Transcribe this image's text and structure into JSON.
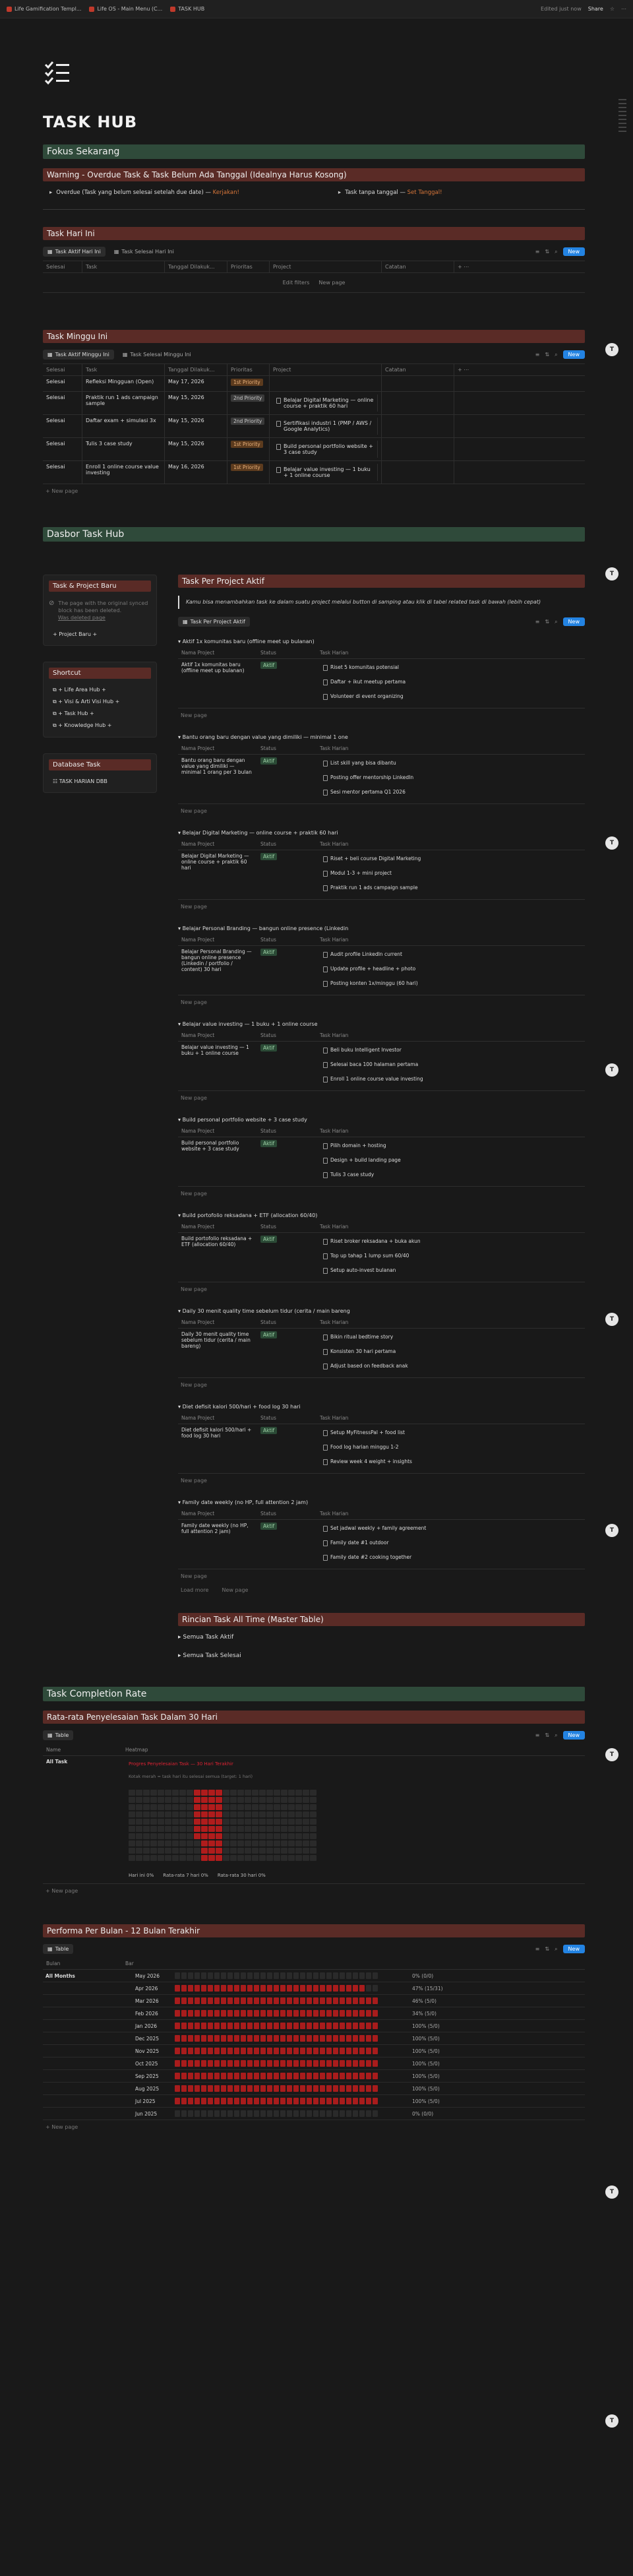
{
  "topbar": {
    "tabs": [
      "Life Gamification Templ...",
      "Life OS - Main Menu (C...",
      "TASK HUB"
    ],
    "edited": "Edited just now",
    "share": "Share"
  },
  "title": "TASK HUB",
  "fokus": {
    "heading": "Fokus Sekarang",
    "warning": "Warning - Overdue Task & Task Belum Ada Tanggal (Idealnya Harus Kosong)",
    "overdue_label": "Overdue (Task yang belum selesai setelah due date)",
    "overdue_link": "Kerjakan!",
    "nodate_label": "Task tanpa tanggal",
    "nodate_link": "Set Tanggal!"
  },
  "hari_ini": {
    "heading": "Task Hari Ini",
    "tab1": "Task Aktif Hari Ini",
    "tab2": "Task Selesai Hari Ini",
    "cols": [
      "Selesai",
      "Task",
      "Tanggal Dilakuk...",
      "Prioritas",
      "Project",
      "Catatan"
    ],
    "empty": [
      "Edit filters",
      "New page"
    ],
    "new": "New"
  },
  "minggu_ini": {
    "heading": "Task Minggu Ini",
    "tab1": "Task Aktif Minggu Ini",
    "tab2": "Task Selesai Minggu Ini",
    "cols": [
      "Selesai",
      "Task",
      "Tanggal Dilakuk...",
      "Prioritas",
      "Project",
      "Catatan"
    ],
    "new": "New",
    "newpage": "New page",
    "rows": [
      {
        "s": "Selesai",
        "t": "Refleksi Mingguan (Open)",
        "d": "May 17, 2026",
        "p": "1st Priority",
        "pc": "orange",
        "proj": [],
        "note": ""
      },
      {
        "s": "Selesai",
        "t": "Praktik run 1 ads campaign sample",
        "d": "May 15, 2026",
        "p": "2nd Priority",
        "pc": "gray",
        "proj": [
          "Belajar Digital Marketing — online course + praktik 60 hari"
        ],
        "note": ""
      },
      {
        "s": "Selesai",
        "t": "Daftar exam + simulasi 3x",
        "d": "May 15, 2026",
        "p": "2nd Priority",
        "pc": "gray",
        "proj": [
          "Sertifikasi industri 1 (PMP / AWS / Google Analytics)"
        ],
        "note": ""
      },
      {
        "s": "Selesai",
        "t": "Tulis 3 case study",
        "d": "May 15, 2026",
        "p": "1st Priority",
        "pc": "orange",
        "proj": [
          "Build personal portfolio website + 3 case study"
        ],
        "note": ""
      },
      {
        "s": "Selesai",
        "t": "Enroll 1 online course value investing",
        "d": "May 16, 2026",
        "p": "1st Priority",
        "pc": "orange",
        "proj": [
          "Belajar value investing — 1 buku + 1 online course"
        ],
        "note": ""
      }
    ]
  },
  "dasbor": {
    "heading": "Dasbor Task Hub",
    "left": {
      "tp_heading": "Task & Project Baru",
      "tp_note": "The page with the original synced block has been deleted.",
      "tp_link": "Was deleted page",
      "tp_item": "+ Project Baru +",
      "sc_heading": "Shortcut",
      "shortcuts": [
        "+ Life Area Hub +",
        "+ Visi & Arti Visi Hub +",
        "+ Task Hub +",
        "+ Knowledge Hub +"
      ],
      "db_heading": "Database Task",
      "db_item": "TASK HARIAN DBB"
    },
    "right": {
      "heading": "Task Per Project Aktif",
      "quote": "Kamu bisa menambahkan task ke dalam suatu project melalui button di samping atau klik di tabel related task di bawah (lebih cepat)",
      "tab": "Task Per Project Aktif",
      "new": "New",
      "cols": [
        "Nama Project",
        "Status",
        "Task Harian"
      ],
      "newpage": "New page",
      "loadmore": "Load more",
      "groups": [
        {
          "title": "Aktif 1x komunitas baru (offline meet up bulanan)",
          "name": "Aktif 1x komunitas baru (offline meet up bulanan)",
          "tasks": [
            "Riset 5 komunitas potensial",
            "Daftar + ikut meetup pertama",
            "Volunteer di event organizing"
          ]
        },
        {
          "title": "Bantu orang baru dengan value yang dimiliki — minimal 1 one",
          "name": "Bantu orang baru dengan value yang dimiliki — minimal 1 orang per 3 bulan",
          "tasks": [
            "List skill yang bisa dibantu",
            "Posting offer mentorship LinkedIn",
            "Sesi mentor pertama Q1 2026"
          ]
        },
        {
          "title": "Belajar Digital Marketing — online course + praktik 60 hari",
          "name": "Belajar Digital Marketing — online course + praktik 60 hari",
          "tasks": [
            "Riset + beli course Digital Marketing",
            "Modul 1-3 + mini project",
            "Praktik run 1 ads campaign sample"
          ]
        },
        {
          "title": "Belajar Personal Branding — bangun online presence (Linkedin",
          "name": "Belajar Personal Branding — bangun online presence (Linkedin / portfolio / content) 30 hari",
          "tasks": [
            "Audit profile LinkedIn current",
            "Update profile + headline + photo",
            "Posting konten 1x/minggu (60 hari)"
          ]
        },
        {
          "title": "Belajar value investing — 1 buku + 1 online course",
          "name": "Belajar value investing — 1 buku + 1 online course",
          "tasks": [
            "Beli buku Intelligent Investor",
            "Selesai baca 100 halaman pertama",
            "Enroll 1 online course value investing"
          ]
        },
        {
          "title": "Build personal portfolio website + 3 case study",
          "name": "Build personal portfolio website + 3 case study",
          "tasks": [
            "Pilih domain + hosting",
            "Design + build landing page",
            "Tulis 3 case study"
          ]
        },
        {
          "title": "Build portofolio reksadana + ETF (allocation 60/40)",
          "name": "Build portofolio reksadana + ETF (allocation 60/40)",
          "tasks": [
            "Riset broker reksadana + buka akun",
            "Top up tahap 1 lump sum 60/40",
            "Setup auto-invest bulanan"
          ]
        },
        {
          "title": "Daily 30 menit quality time sebelum tidur (cerita / main bareng",
          "name": "Daily 30 menit quality time sebelum tidur (cerita / main bareng)",
          "tasks": [
            "Bikin ritual bedtime story",
            "Konsisten 30 hari pertama",
            "Adjust based on feedback anak"
          ]
        },
        {
          "title": "Diet defisit kalori 500/hari + food log 30 hari",
          "name": "Diet defisit kalori 500/hari + food log 30 hari",
          "tasks": [
            "Setup MyFitnessPal + food list",
            "Food log harian minggu 1-2",
            "Review week 4 weight + insights"
          ]
        },
        {
          "title": "Family date weekly (no HP, full attention 2 jam)",
          "name": "Family date weekly (no HP, full attention 2 jam)",
          "tasks": [
            "Set jadwal weekly + family agreement",
            "Family date #1 outdoor",
            "Family date #2 cooking together"
          ]
        }
      ],
      "status": "Aktif",
      "rincian_heading": "Rincian Task All Time (Master Table)",
      "rincian_items": [
        "Semua Task Aktif",
        "Semua Task Selesai"
      ]
    }
  },
  "completion": {
    "heading": "Task Completion Rate",
    "sub": "Rata-rata Penyelesaian Task Dalam 30 Hari",
    "tab": "Table",
    "new": "New",
    "cols": [
      "Name",
      "Heatmap"
    ],
    "row": "All Task",
    "heat_title": "Progres Penyelesaian Task — 30 Hari Terakhir",
    "heat_sub": "Kotak merah = task hari itu selesai semua (target: 1 hari)",
    "heat_foot": "Hari ini 0%",
    "heat_foot2": "Rata-rata 7 hari 0%",
    "heat_foot3": "Rata-rata 30 hari 0%",
    "newpage": "New page"
  },
  "bulan": {
    "heading": "Performa Per Bulan - 12 Bulan Terakhir",
    "tab": "Table",
    "new": "New",
    "cols": [
      "Bulan",
      "Bar"
    ],
    "row": "All Months",
    "months": [
      {
        "m": "May 2026",
        "fill": 0,
        "v": "0% (0/0)"
      },
      {
        "m": "Apr 2026",
        "fill": 29,
        "v": "47% (15/31)"
      },
      {
        "m": "Mar 2026",
        "fill": 31,
        "v": "46% (5/0)"
      },
      {
        "m": "Feb 2026",
        "fill": 31,
        "v": "34% (5/0)"
      },
      {
        "m": "Jan 2026",
        "fill": 31,
        "v": "100% (5/0)"
      },
      {
        "m": "Dec 2025",
        "fill": 31,
        "v": "100% (5/0)"
      },
      {
        "m": "Nov 2025",
        "fill": 31,
        "v": "100% (5/0)"
      },
      {
        "m": "Oct 2025",
        "fill": 31,
        "v": "100% (5/0)"
      },
      {
        "m": "Sep 2025",
        "fill": 31,
        "v": "100% (5/0)"
      },
      {
        "m": "Aug 2025",
        "fill": 31,
        "v": "100% (5/0)"
      },
      {
        "m": "Jul 2025",
        "fill": 31,
        "v": "100% (5/0)"
      },
      {
        "m": "Jun 2025",
        "fill": 0,
        "v": "0% (0/0)"
      }
    ],
    "newpage": "New page"
  }
}
